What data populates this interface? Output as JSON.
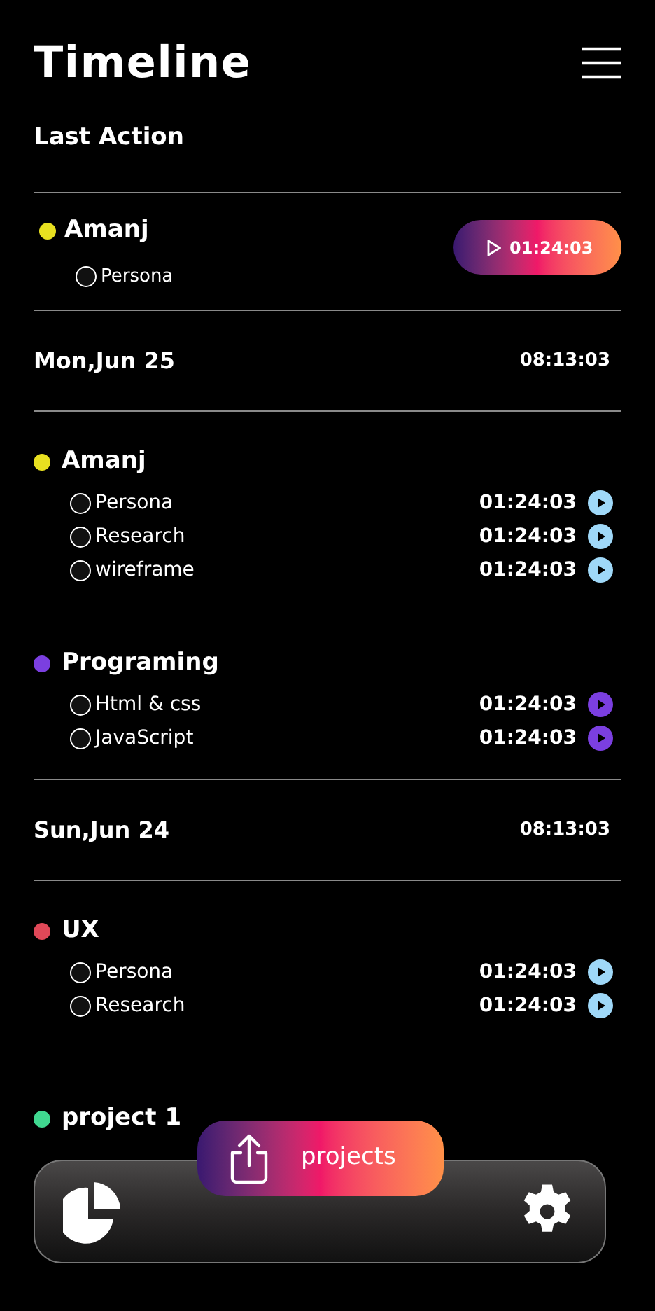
{
  "header": {
    "title": "Timeline"
  },
  "last_action": {
    "heading": "Last Action",
    "group": "Amanj",
    "color": "#e8e020",
    "task": "Persona",
    "time": "01:24:03"
  },
  "days": [
    {
      "date": "Mon,Jun 25",
      "total": "08:13:03",
      "groups": [
        {
          "name": "Amanj",
          "color": "#e8e020",
          "tasks": [
            {
              "name": "Persona",
              "time": "01:24:03",
              "color": "#9fd8f8"
            },
            {
              "name": "Research",
              "time": "01:24:03",
              "color": "#9fd8f8"
            },
            {
              "name": "wireframe",
              "time": "01:24:03",
              "color": "#9fd8f8"
            }
          ]
        },
        {
          "name": "Programing",
          "color": "#7b3fe0",
          "tasks": [
            {
              "name": "Html & css",
              "time": "01:24:03",
              "color": "#7b3fe0"
            },
            {
              "name": "JavaScript",
              "time": "01:24:03",
              "color": "#7b3fe0"
            }
          ]
        }
      ]
    },
    {
      "date": "Sun,Jun 24",
      "total": "08:13:03",
      "groups": [
        {
          "name": "UX",
          "color": "#e04858",
          "tasks": [
            {
              "name": "Persona",
              "time": "01:24:03",
              "color": "#9fd8f8"
            },
            {
              "name": "Research",
              "time": "01:24:03",
              "color": "#9fd8f8"
            }
          ]
        },
        {
          "name": "project 1",
          "color": "#40d890"
        }
      ]
    }
  ],
  "nav": {
    "button_label": "projects"
  }
}
